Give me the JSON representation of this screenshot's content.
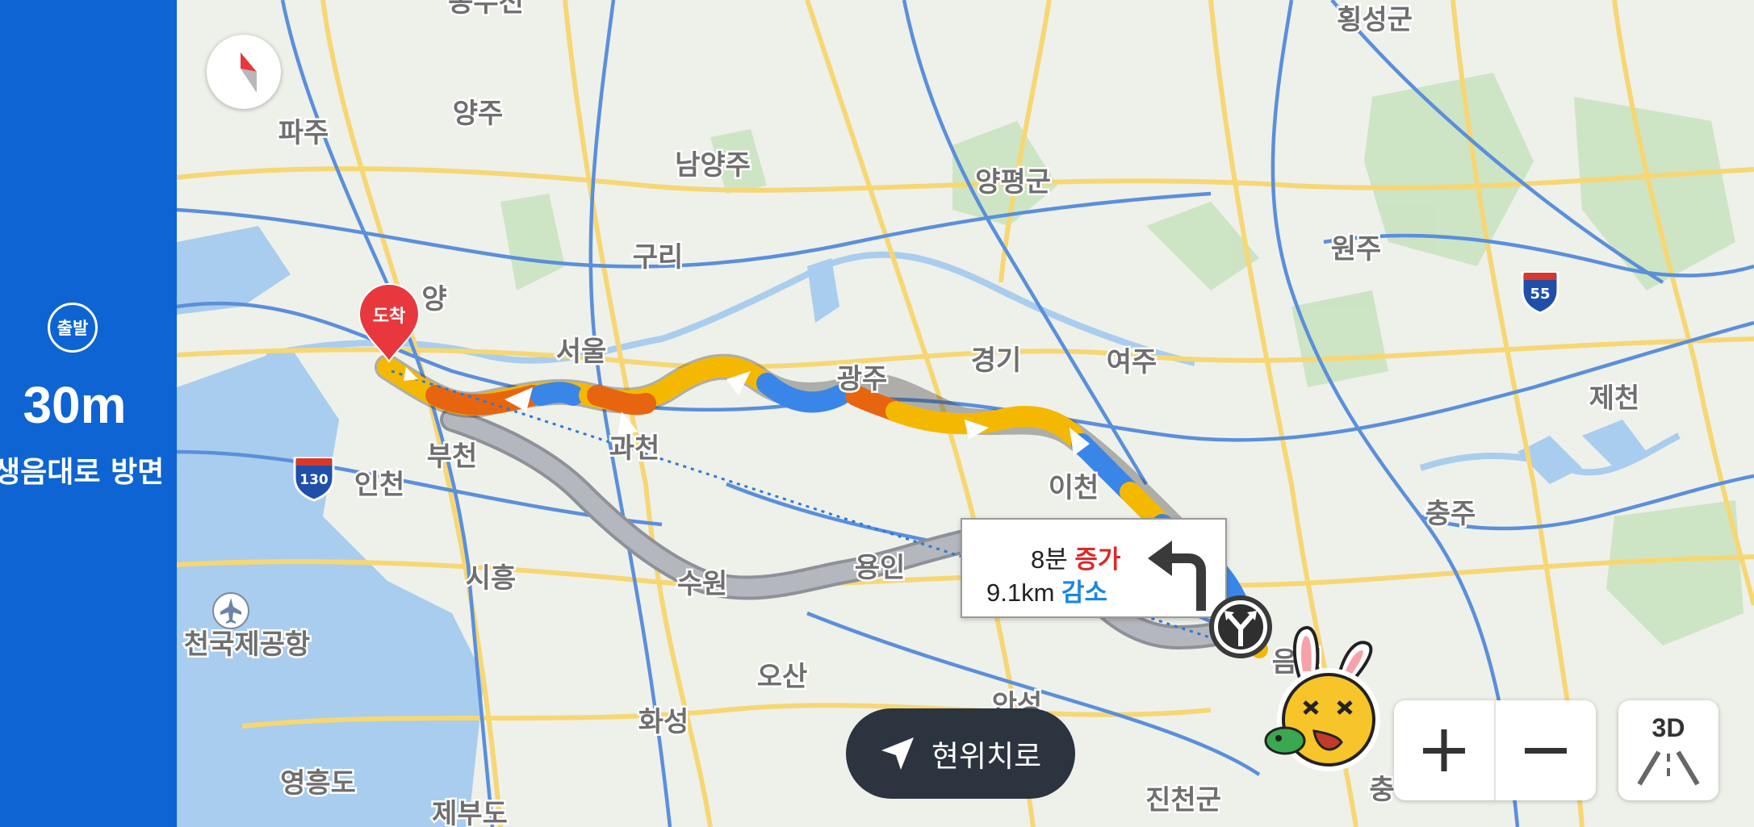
{
  "map": {
    "city_labels": [
      {
        "key": "yangju",
        "text": "양주"
      },
      {
        "key": "paju",
        "text": "파주"
      },
      {
        "key": "namyangju",
        "text": "남양주"
      },
      {
        "key": "yangpyeong",
        "text": "양평군"
      },
      {
        "key": "hoengseong",
        "text": "횡성군"
      },
      {
        "key": "guri",
        "text": "구리"
      },
      {
        "key": "wonju",
        "text": "원주"
      },
      {
        "key": "seoul",
        "text": "서울"
      },
      {
        "key": "gwangju",
        "text": "광주"
      },
      {
        "key": "gyeonggi",
        "text": "경기"
      },
      {
        "key": "yeoju",
        "text": "여주"
      },
      {
        "key": "jecheon",
        "text": "제천"
      },
      {
        "key": "bucheon",
        "text": "부천"
      },
      {
        "key": "gwacheon",
        "text": "과천"
      },
      {
        "key": "incheon",
        "text": "인천"
      },
      {
        "key": "icheon",
        "text": "이천"
      },
      {
        "key": "chungju",
        "text": "충주"
      },
      {
        "key": "siheung",
        "text": "시흥"
      },
      {
        "key": "suwon",
        "text": "수원"
      },
      {
        "key": "yongin",
        "text": "용인"
      },
      {
        "key": "airport",
        "text": "천국제공항"
      },
      {
        "key": "osan",
        "text": "오산"
      },
      {
        "key": "hwaseong",
        "text": "화성"
      },
      {
        "key": "anseong",
        "text": "안성"
      },
      {
        "key": "yeongheungdo",
        "text": "영흥도"
      },
      {
        "key": "jincheon",
        "text": "진천군"
      },
      {
        "key": "jebudo",
        "text": "제부도"
      },
      {
        "key": "eumseong",
        "text": "음성"
      },
      {
        "key": "yang_partial",
        "text": "양"
      },
      {
        "key": "top_partial",
        "text": "동두천"
      },
      {
        "key": "chung_partial",
        "text": "충"
      }
    ],
    "highway_shields": [
      {
        "key": "i130",
        "text": "130",
        "color": "#1f4fa8"
      },
      {
        "key": "i55",
        "text": "55",
        "color": "#1f4fa8"
      }
    ],
    "destination_label": "도착",
    "route_colors": {
      "slow": "#f5b800",
      "congested": "#e8650f",
      "smooth": "#3a86e8",
      "alternative": "#a9acb2"
    },
    "water_color": "#a9cdee",
    "land_color": "#eef0ea"
  },
  "guidance": {
    "departure_badge": "출발",
    "distance": "30m",
    "direction": "생음대로 방면"
  },
  "alt_route": {
    "time_prefix": "8분 ",
    "time_change": "증가",
    "distance_prefix": "9.1km ",
    "distance_change": "감소",
    "turn_icon": "turn-left-arrow-icon"
  },
  "controls": {
    "recenter_label": "현위치로",
    "zoom_in_icon": "plus-icon",
    "zoom_out_icon": "minus-icon",
    "view3d_label": "3D",
    "compass_icon": "compass-icon"
  }
}
